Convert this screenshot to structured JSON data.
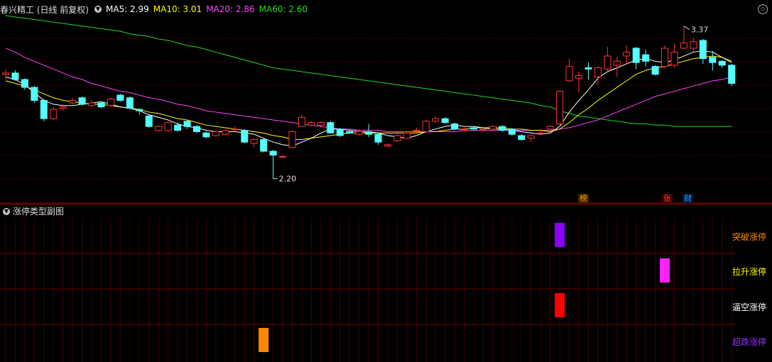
{
  "header": {
    "title": "春兴精工 (日线 前复权)",
    "ma_items": [
      {
        "label": "MA5: 2.99",
        "color": "#ffffff"
      },
      {
        "label": "MA10: 3.01",
        "color": "#ffff00"
      },
      {
        "label": "MA20: 2.86",
        "color": "#ff44ff"
      },
      {
        "label": "MA60: 2.60",
        "color": "#22dd22"
      }
    ]
  },
  "annotations": {
    "high_label": "3.37",
    "low_label": "2.20"
  },
  "markers": [
    {
      "text": "榜",
      "color": "#ff9900",
      "bg": "#3a2600"
    },
    {
      "text": "张",
      "color": "#ff3333",
      "bg": "#3a0000"
    },
    {
      "text": "财",
      "color": "#3399ff",
      "bg": "#001a3a"
    }
  ],
  "sub_chart": {
    "title": "涨停类型副图",
    "labels": [
      {
        "text": "突破涨停",
        "color": "#ff8800"
      },
      {
        "text": "拉升涨停",
        "color": "#ffff00"
      },
      {
        "text": "逼空涨停",
        "color": "#ffffff"
      },
      {
        "text": "超跌涨停",
        "color": "#9933ff"
      }
    ]
  },
  "chart_data": {
    "type": "candlestick",
    "ylim": [
      2.1,
      3.45
    ],
    "colors": {
      "up": "#ff3232",
      "down": "#54ffff",
      "ma5": "#ffffff",
      "ma10": "#ffff00",
      "ma20": "#ff44ff",
      "ma60": "#22dd22"
    },
    "candles": [
      [
        3.0,
        3.01,
        3.04,
        2.96
      ],
      [
        3.01,
        2.96,
        3.03,
        2.95
      ],
      [
        2.96,
        2.9,
        2.97,
        2.88
      ],
      [
        2.9,
        2.8,
        2.91,
        2.78
      ],
      [
        2.8,
        2.66,
        2.81,
        2.64
      ],
      [
        2.66,
        2.73,
        2.75,
        2.65
      ],
      [
        2.74,
        2.75,
        2.77,
        2.72
      ],
      [
        2.78,
        2.8,
        2.82,
        2.77
      ],
      [
        2.82,
        2.77,
        2.83,
        2.76
      ],
      [
        2.76,
        2.78,
        2.8,
        2.75
      ],
      [
        2.78,
        2.75,
        2.79,
        2.74
      ],
      [
        2.76,
        2.81,
        2.82,
        2.75
      ],
      [
        2.84,
        2.8,
        2.85,
        2.79
      ],
      [
        2.82,
        2.74,
        2.83,
        2.73
      ],
      [
        2.73,
        2.72,
        2.74,
        2.69
      ],
      [
        2.68,
        2.6,
        2.69,
        2.59
      ],
      [
        2.57,
        2.6,
        2.61,
        2.56
      ],
      [
        2.57,
        2.63,
        2.64,
        2.56
      ],
      [
        2.61,
        2.57,
        2.63,
        2.56
      ],
      [
        2.64,
        2.6,
        2.65,
        2.58
      ],
      [
        2.6,
        2.56,
        2.61,
        2.55
      ],
      [
        2.55,
        2.52,
        2.56,
        2.51
      ],
      [
        2.53,
        2.56,
        2.57,
        2.52
      ],
      [
        2.54,
        2.57,
        2.58,
        2.53
      ],
      [
        2.58,
        2.58,
        2.6,
        2.56
      ],
      [
        2.57,
        2.48,
        2.58,
        2.47
      ],
      [
        2.47,
        2.5,
        2.51,
        2.44
      ],
      [
        2.5,
        2.41,
        2.51,
        2.4
      ],
      [
        2.41,
        2.38,
        2.42,
        2.2
      ],
      [
        2.37,
        2.37,
        2.38,
        2.36
      ],
      [
        2.44,
        2.56,
        2.57,
        2.43
      ],
      [
        2.6,
        2.67,
        2.69,
        2.6
      ],
      [
        2.61,
        2.63,
        2.64,
        2.6
      ],
      [
        2.61,
        2.63,
        2.64,
        2.59
      ],
      [
        2.63,
        2.55,
        2.64,
        2.55
      ],
      [
        2.58,
        2.53,
        2.59,
        2.52
      ],
      [
        2.56,
        2.55,
        2.57,
        2.54
      ],
      [
        2.54,
        2.56,
        2.58,
        2.53
      ],
      [
        2.56,
        2.54,
        2.62,
        2.52
      ],
      [
        2.54,
        2.48,
        2.55,
        2.46
      ],
      [
        2.45,
        2.46,
        2.47,
        2.44
      ],
      [
        2.49,
        2.53,
        2.54,
        2.48
      ],
      [
        2.51,
        2.55,
        2.56,
        2.51
      ],
      [
        2.57,
        2.57,
        2.59,
        2.55
      ],
      [
        2.56,
        2.64,
        2.65,
        2.55
      ],
      [
        2.64,
        2.66,
        2.68,
        2.63
      ],
      [
        2.66,
        2.63,
        2.67,
        2.62
      ],
      [
        2.62,
        2.58,
        2.63,
        2.57
      ],
      [
        2.58,
        2.58,
        2.6,
        2.56
      ],
      [
        2.59,
        2.58,
        2.6,
        2.57
      ],
      [
        2.58,
        2.58,
        2.6,
        2.56
      ],
      [
        2.58,
        2.6,
        2.61,
        2.57
      ],
      [
        2.6,
        2.57,
        2.61,
        2.56
      ],
      [
        2.58,
        2.54,
        2.59,
        2.53
      ],
      [
        2.53,
        2.5,
        2.54,
        2.49
      ],
      [
        2.51,
        2.53,
        2.54,
        2.48
      ],
      [
        2.55,
        2.55,
        2.58,
        2.54
      ],
      [
        2.58,
        2.6,
        2.61,
        2.57
      ],
      [
        2.62,
        2.87,
        2.88,
        2.61
      ],
      [
        2.95,
        3.06,
        3.12,
        2.94
      ],
      [
        2.97,
        2.99,
        3.02,
        2.86
      ],
      [
        3.05,
        3.04,
        3.09,
        2.96
      ],
      [
        2.98,
        3.05,
        3.06,
        2.92
      ],
      [
        3.04,
        3.14,
        3.21,
        3.02
      ],
      [
        3.07,
        3.1,
        3.13,
        2.98
      ],
      [
        3.14,
        3.17,
        3.22,
        3.08
      ],
      [
        3.2,
        3.09,
        3.21,
        3.04
      ],
      [
        3.15,
        3.1,
        3.19,
        3.06
      ],
      [
        3.06,
        3.0,
        3.07,
        2.99
      ],
      [
        3.06,
        3.2,
        3.22,
        3.04
      ],
      [
        3.07,
        3.17,
        3.23,
        3.05
      ],
      [
        3.2,
        3.24,
        3.37,
        3.19
      ],
      [
        3.2,
        3.25,
        3.28,
        3.17
      ],
      [
        3.26,
        3.12,
        3.27,
        3.08
      ],
      [
        3.13,
        3.09,
        3.18,
        3.03
      ],
      [
        3.1,
        3.07,
        3.11,
        3.05
      ],
      [
        3.07,
        2.93,
        3.08,
        2.91
      ]
    ],
    "ma5": [
      2.98,
      2.96,
      2.92,
      2.86,
      2.8,
      2.77,
      2.76,
      2.76,
      2.77,
      2.78,
      2.79,
      2.77,
      2.75,
      2.74,
      2.72,
      2.69,
      2.67,
      2.65,
      2.62,
      2.6,
      2.59,
      2.57,
      2.56,
      2.56,
      2.56,
      2.55,
      2.54,
      2.51,
      2.48,
      2.46,
      2.45,
      2.48,
      2.51,
      2.55,
      2.58,
      2.58,
      2.57,
      2.56,
      2.56,
      2.55,
      2.53,
      2.52,
      2.51,
      2.53,
      2.56,
      2.58,
      2.6,
      2.61,
      2.6,
      2.6,
      2.59,
      2.58,
      2.58,
      2.57,
      2.56,
      2.55,
      2.54,
      2.55,
      2.6,
      2.71,
      2.8,
      2.88,
      2.97,
      3.02,
      3.05,
      3.08,
      3.11,
      3.12,
      3.1,
      3.09,
      3.11,
      3.14,
      3.17,
      3.18,
      3.17,
      3.13,
      3.1
    ],
    "ma10": [
      2.95,
      2.93,
      2.91,
      2.88,
      2.85,
      2.82,
      2.8,
      2.79,
      2.78,
      2.77,
      2.77,
      2.76,
      2.75,
      2.74,
      2.73,
      2.71,
      2.7,
      2.68,
      2.66,
      2.65,
      2.63,
      2.61,
      2.6,
      2.59,
      2.58,
      2.57,
      2.56,
      2.55,
      2.53,
      2.52,
      2.5,
      2.5,
      2.51,
      2.52,
      2.53,
      2.54,
      2.55,
      2.55,
      2.55,
      2.55,
      2.55,
      2.55,
      2.55,
      2.55,
      2.56,
      2.56,
      2.57,
      2.58,
      2.58,
      2.59,
      2.59,
      2.59,
      2.59,
      2.58,
      2.58,
      2.57,
      2.57,
      2.56,
      2.58,
      2.63,
      2.69,
      2.74,
      2.8,
      2.85,
      2.9,
      2.95,
      3.0,
      3.03,
      3.05,
      3.06,
      3.08,
      3.1,
      3.12,
      3.13,
      3.14,
      3.13,
      3.09
    ],
    "ma20": [
      3.2,
      3.17,
      3.13,
      3.1,
      3.07,
      3.04,
      3.01,
      2.98,
      2.96,
      2.93,
      2.91,
      2.89,
      2.87,
      2.86,
      2.84,
      2.82,
      2.81,
      2.79,
      2.77,
      2.76,
      2.74,
      2.72,
      2.71,
      2.7,
      2.69,
      2.68,
      2.67,
      2.66,
      2.65,
      2.64,
      2.63,
      2.62,
      2.61,
      2.6,
      2.59,
      2.58,
      2.58,
      2.57,
      2.57,
      2.57,
      2.56,
      2.56,
      2.56,
      2.56,
      2.56,
      2.56,
      2.56,
      2.56,
      2.57,
      2.57,
      2.57,
      2.57,
      2.57,
      2.57,
      2.57,
      2.57,
      2.57,
      2.57,
      2.58,
      2.59,
      2.61,
      2.63,
      2.65,
      2.68,
      2.71,
      2.74,
      2.77,
      2.8,
      2.83,
      2.85,
      2.87,
      2.89,
      2.91,
      2.93,
      2.95,
      2.96,
      2.98
    ],
    "ma60": [
      3.45,
      3.44,
      3.43,
      3.42,
      3.41,
      3.4,
      3.39,
      3.38,
      3.37,
      3.36,
      3.35,
      3.34,
      3.33,
      3.31,
      3.3,
      3.29,
      3.27,
      3.26,
      3.24,
      3.22,
      3.21,
      3.19,
      3.17,
      3.15,
      3.13,
      3.11,
      3.09,
      3.07,
      3.05,
      3.04,
      3.03,
      3.02,
      3.01,
      3.0,
      2.99,
      2.98,
      2.97,
      2.96,
      2.95,
      2.94,
      2.93,
      2.92,
      2.91,
      2.9,
      2.89,
      2.88,
      2.87,
      2.86,
      2.85,
      2.84,
      2.83,
      2.82,
      2.81,
      2.8,
      2.79,
      2.78,
      2.76,
      2.75,
      2.72,
      2.7,
      2.68,
      2.67,
      2.66,
      2.65,
      2.64,
      2.63,
      2.62,
      2.62,
      2.61,
      2.61,
      2.6,
      2.6,
      2.6,
      2.6,
      2.6,
      2.6,
      2.6
    ],
    "limit_up_bars": [
      {
        "index": 27,
        "type": "超跌涨停",
        "color": "#ff8800"
      },
      {
        "index": 58,
        "type": "突破涨停",
        "color": "#8800ff"
      },
      {
        "index": 58,
        "type": "逼空涨停",
        "color": "#ff0000"
      },
      {
        "index": 69,
        "type": "拉升涨停",
        "color": "#ff22ff"
      }
    ]
  }
}
